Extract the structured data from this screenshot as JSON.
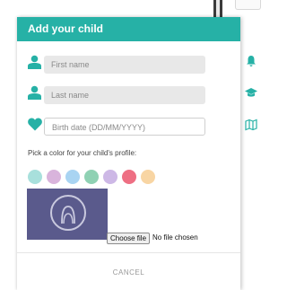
{
  "modal": {
    "title": "Add your child",
    "first_name_placeholder": "First name",
    "last_name_placeholder": "Last name",
    "birth_date_placeholder": "Birth date (DD/MM/YYYY)",
    "color_label": "Pick a color for your child's profile:",
    "colors": [
      "#a8e0dc",
      "#d9b4dc",
      "#a9d4f2",
      "#8fd1b3",
      "#cdb8e6",
      "#ee6f83",
      "#f8d5a3"
    ],
    "choose_file_label": "Choose file",
    "no_file_text": "No file chosen",
    "cancel_label": "CANCEL"
  },
  "theme": {
    "accent": "#26b1a6"
  },
  "side_icons": [
    "bell-icon",
    "graduation-cap-icon",
    "map-icon"
  ]
}
